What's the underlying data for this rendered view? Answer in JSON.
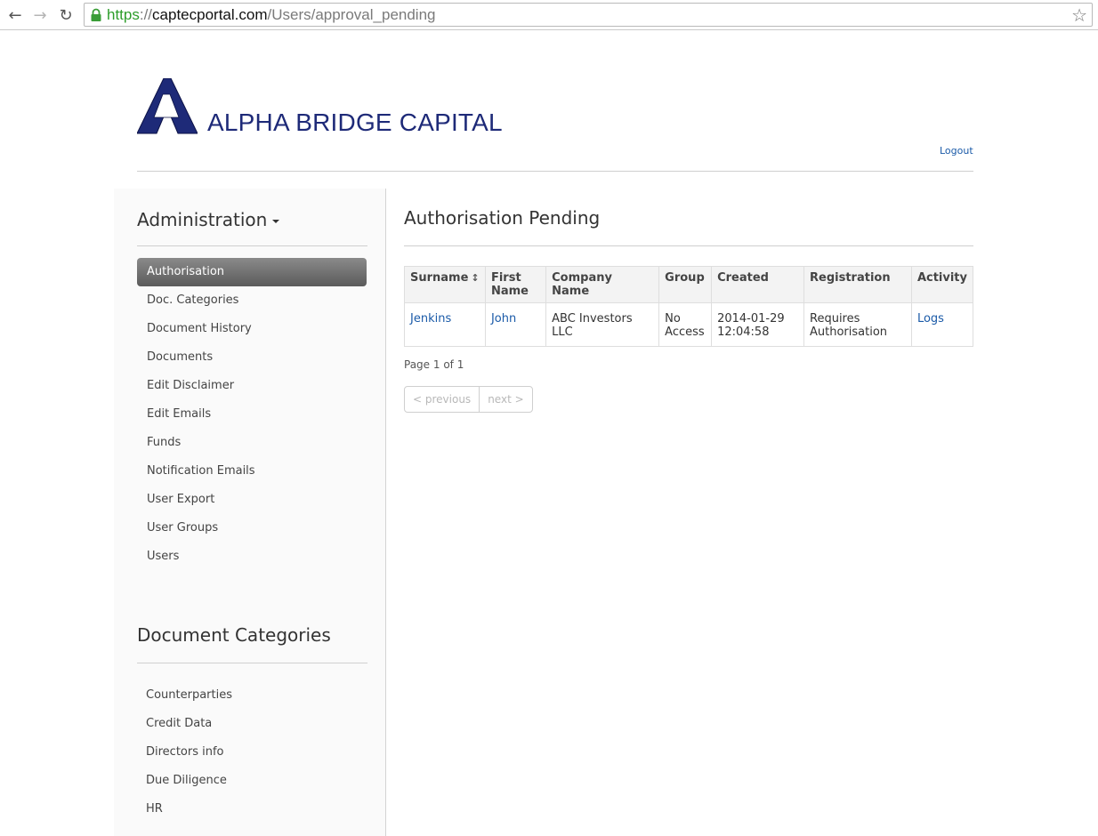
{
  "browser": {
    "url_scheme": "https",
    "url_sep": "://",
    "url_host": "captecportal.com",
    "url_path": "/Users/approval_pending"
  },
  "header": {
    "brand": "ALPHA BRIDGE CAPITAL",
    "logout": "Logout",
    "brand_color": "#1e2a78"
  },
  "sidebar": {
    "admin_title": "Administration",
    "items": [
      {
        "label": "Authorisation",
        "active": true
      },
      {
        "label": "Doc. Categories"
      },
      {
        "label": "Document History"
      },
      {
        "label": "Documents"
      },
      {
        "label": "Edit Disclaimer"
      },
      {
        "label": "Edit Emails"
      },
      {
        "label": "Funds"
      },
      {
        "label": "Notification Emails"
      },
      {
        "label": "User Export"
      },
      {
        "label": "User Groups"
      },
      {
        "label": "Users"
      }
    ],
    "doc_title": "Document Categories",
    "doc_items": [
      {
        "label": "Counterparties"
      },
      {
        "label": "Credit Data"
      },
      {
        "label": "Directors info"
      },
      {
        "label": "Due Diligence"
      },
      {
        "label": "HR"
      }
    ]
  },
  "main": {
    "title": "Authorisation Pending",
    "table": {
      "headers": [
        "Surname",
        "First Name",
        "Company Name",
        "Group",
        "Created",
        "Registration",
        "Activity"
      ],
      "rows": [
        {
          "surname": "Jenkins",
          "first_name": "John",
          "company": "ABC Investors LLC",
          "group": "No Access",
          "created": "2014-01-29 12:04:58",
          "registration": "Requires Authorisation",
          "activity": "Logs"
        }
      ]
    },
    "page_info": "Page 1 of 1",
    "pager": {
      "previous": "< previous",
      "next": "next >"
    }
  }
}
